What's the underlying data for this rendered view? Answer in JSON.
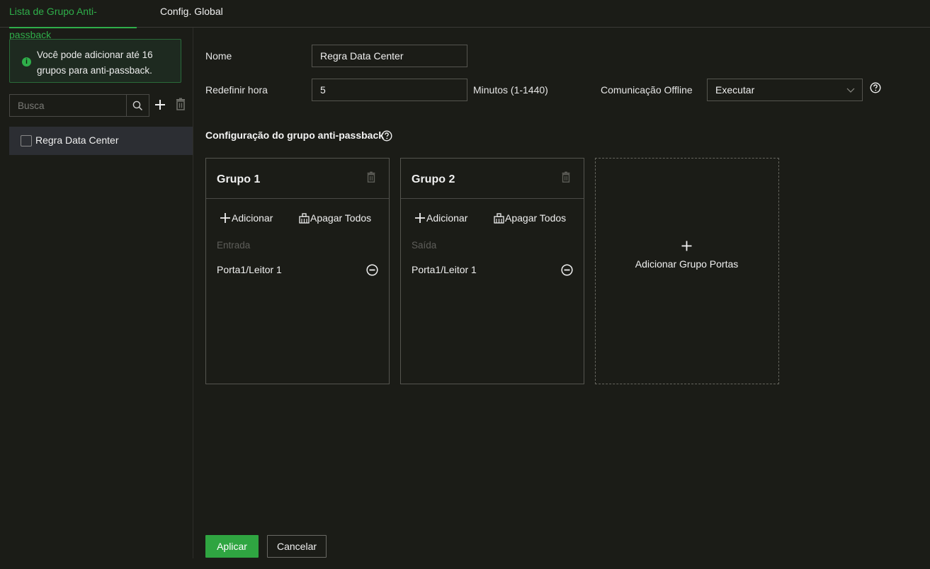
{
  "tabs": [
    {
      "label": "Lista de Grupo Anti-passback",
      "active": true
    },
    {
      "label": "Config. Global",
      "active": false
    }
  ],
  "sidebar": {
    "info_text": "Você pode adicionar até 16 grupos para anti-passback.",
    "search_placeholder": "Busca",
    "items": [
      {
        "label": "Regra Data Center",
        "checked": false
      }
    ]
  },
  "form": {
    "name_label": "Nome",
    "name_value": "Regra Data Center",
    "reset_label": "Redefinir hora",
    "reset_value": "5",
    "reset_unit": "Minutos (1-1440)",
    "offline_label": "Comunicação Offline",
    "offline_value": "Executar"
  },
  "groups_section": {
    "title": "Configuração do grupo anti-passback",
    "add_label": "Adicionar",
    "clear_label": "Apagar Todos",
    "groups": [
      {
        "title": "Grupo 1",
        "type": "Entrada",
        "doors": [
          "Porta1/Leitor 1"
        ]
      },
      {
        "title": "Grupo 2",
        "type": "Saída",
        "doors": [
          "Porta1/Leitor 1"
        ]
      }
    ],
    "add_group_label": "Adicionar Grupo Portas"
  },
  "actions": {
    "apply": "Aplicar",
    "cancel": "Cancelar"
  },
  "colors": {
    "accent": "#2fae4a",
    "background": "#1b1c17",
    "selected_row": "#2c2e33"
  },
  "icons": [
    "info-icon",
    "search-icon",
    "plus-icon",
    "trash-icon",
    "help-icon",
    "chevron-down-icon",
    "clear-icon",
    "remove-circle-icon"
  ]
}
